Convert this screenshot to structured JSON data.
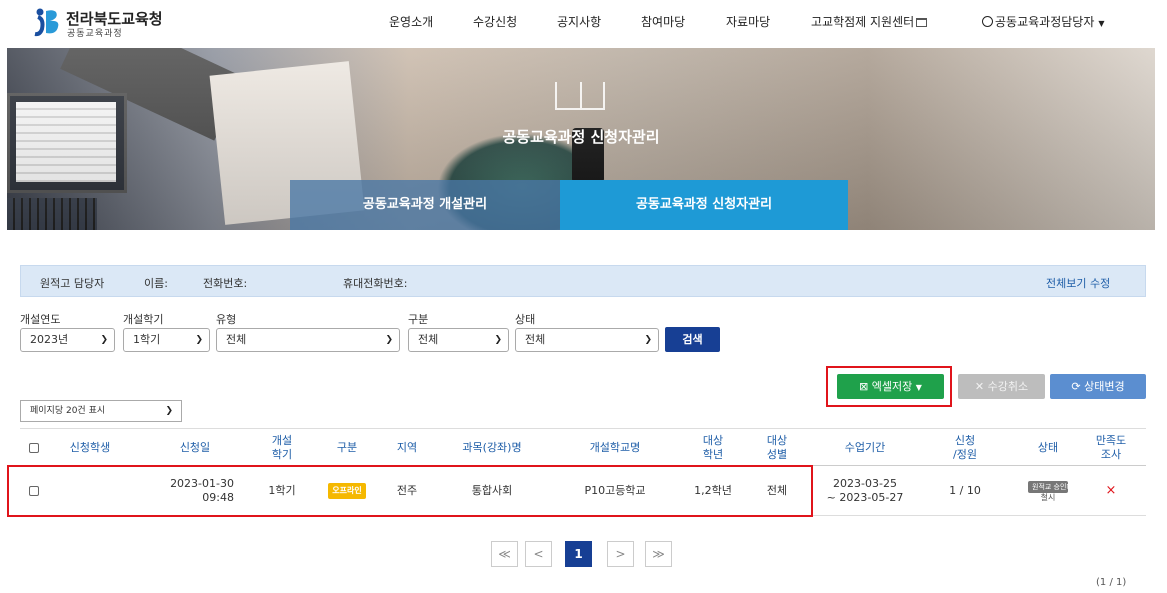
{
  "header": {
    "logo_title": "전라북도교육청",
    "logo_subtitle": "공동교육과정",
    "nav": [
      "운영소개",
      "수강신청",
      "공지사항",
      "참여마당",
      "자료마당",
      "고교학점제 지원센터"
    ],
    "user_label": "공동교육과정담당자"
  },
  "banner": {
    "title": "공동교육과정 신청자관리",
    "tabs": [
      "공동교육과정 개설관리",
      "공동교육과정 신청자관리"
    ]
  },
  "info_bar": {
    "label": "원적고 담당자",
    "name_label": "이름:",
    "phone_label": "전화번호:",
    "mobile_label": "휴대전화번호:",
    "edit_link": "전체보기 수정"
  },
  "filters": {
    "year_label": "개설연도",
    "year_value": "2023년",
    "semester_label": "개설학기",
    "semester_value": "1학기",
    "type_label": "유형",
    "type_value": "전체",
    "category_label": "구분",
    "category_value": "전체",
    "status_label": "상태",
    "status_value": "전체",
    "search_button": "검색"
  },
  "actions": {
    "excel": "엑셀저장",
    "cancel": "수강취소",
    "status_change": "상태변경"
  },
  "per_page": "페이지당 20건 표시",
  "table": {
    "headers": [
      "신청학생",
      "신청일",
      "개설\n학기",
      "구분",
      "지역",
      "과목(강좌)명",
      "개설학교명",
      "대상\n학년",
      "대상\n성별",
      "수업기간",
      "신청\n/정원",
      "상태",
      "만족도\n조사"
    ],
    "rows": [
      {
        "student": "",
        "date": "2023-01-30",
        "time": "09:48",
        "semester": "1학기",
        "category": "오프라인",
        "region": "전주",
        "course": "통합사회",
        "school": "P10고등학교",
        "grade": "1,2학년",
        "gender": "전체",
        "period_start": "2023-03-25",
        "period_end": "~ 2023-05-27",
        "quota": "1 / 10",
        "status_badge": "원적교 승인대기",
        "status_sub": "철시",
        "survey": "×"
      }
    ]
  },
  "pagination": {
    "first": "≪",
    "prev": "<",
    "current": "1",
    "next": ">",
    "last": "≫",
    "count": "(1 / 1)"
  },
  "colors": {
    "primary": "#173f94",
    "tab_active": "#1e9ad6",
    "excel": "#1fa14b",
    "highlight": "#e0141b"
  }
}
